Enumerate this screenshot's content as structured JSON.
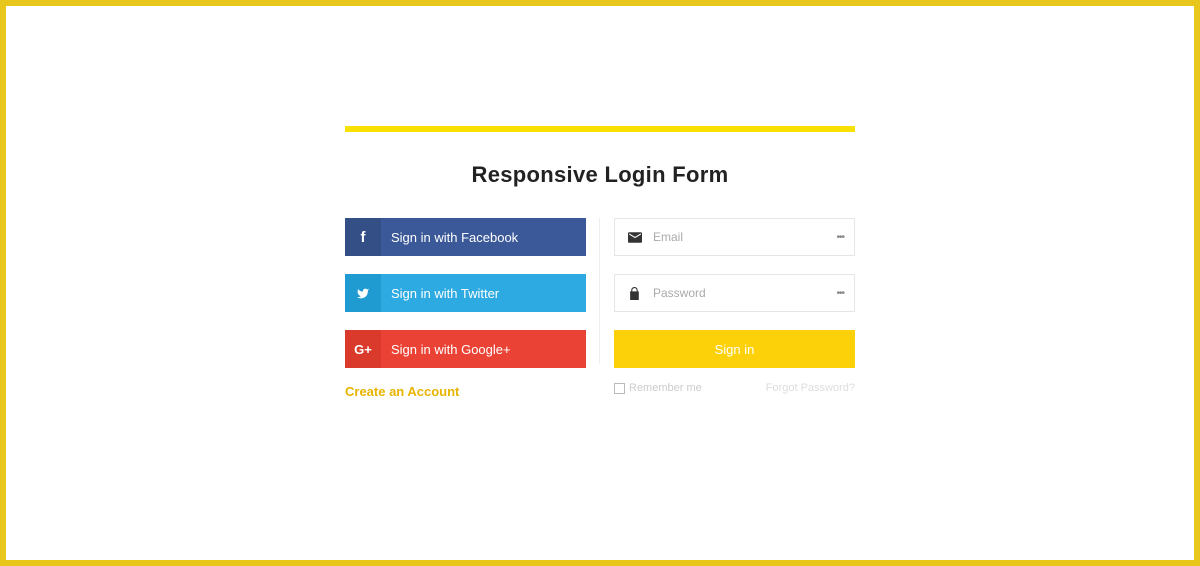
{
  "title": "Responsive Login Form",
  "social": {
    "facebook": {
      "label": "Sign in with Facebook",
      "icon": "f"
    },
    "twitter": {
      "label": "Sign in with Twitter"
    },
    "google": {
      "label": "Sign in with Google+",
      "icon": "G+"
    }
  },
  "create_account": "Create an Account",
  "form": {
    "email_placeholder": "Email",
    "password_placeholder": "Password",
    "signin": "Sign in",
    "remember": "Remember me",
    "forgot": "Forgot Password?"
  }
}
